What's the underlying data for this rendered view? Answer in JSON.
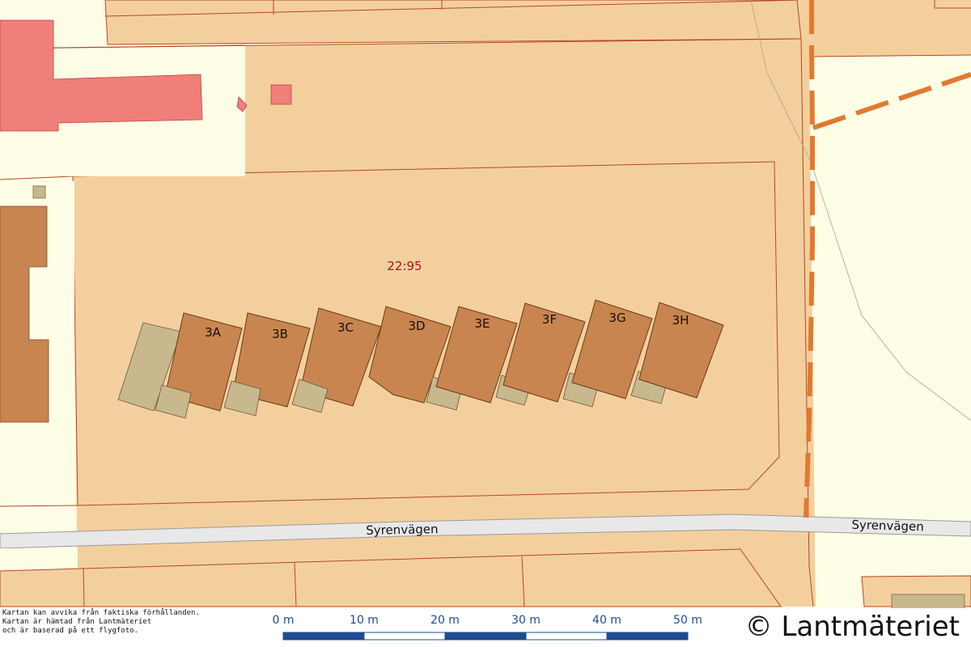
{
  "map": {
    "parcel_label": "22:95",
    "street_name": "Syrenvägen",
    "buildings": [
      {
        "label": "3A"
      },
      {
        "label": "3B"
      },
      {
        "label": "3C"
      },
      {
        "label": "3D"
      },
      {
        "label": "3E"
      },
      {
        "label": "3F"
      },
      {
        "label": "3G"
      },
      {
        "label": "3H"
      }
    ],
    "colors": {
      "background": "#fefde6",
      "parcel": "#f4cf9e",
      "boundary": "#b24a1e",
      "building": "#c8854f",
      "annex": "#c8b88e",
      "commercial": "#ef7f78",
      "road": "#e8e8e8",
      "municipal_border": "#e07a30",
      "label": "#b0101a"
    }
  },
  "footer": {
    "disclaimer": [
      "Kartan kan avvika från faktiska förhållanden.",
      "Kartan är hämtad från Lantmäteriet",
      "och är baserad på ett flygfoto."
    ],
    "copyright": "© Lantmäteriet",
    "scale": {
      "ticks": [
        "0 m",
        "10 m",
        "20 m",
        "30 m",
        "40 m",
        "50 m"
      ],
      "color": "#1f4b8f"
    }
  }
}
